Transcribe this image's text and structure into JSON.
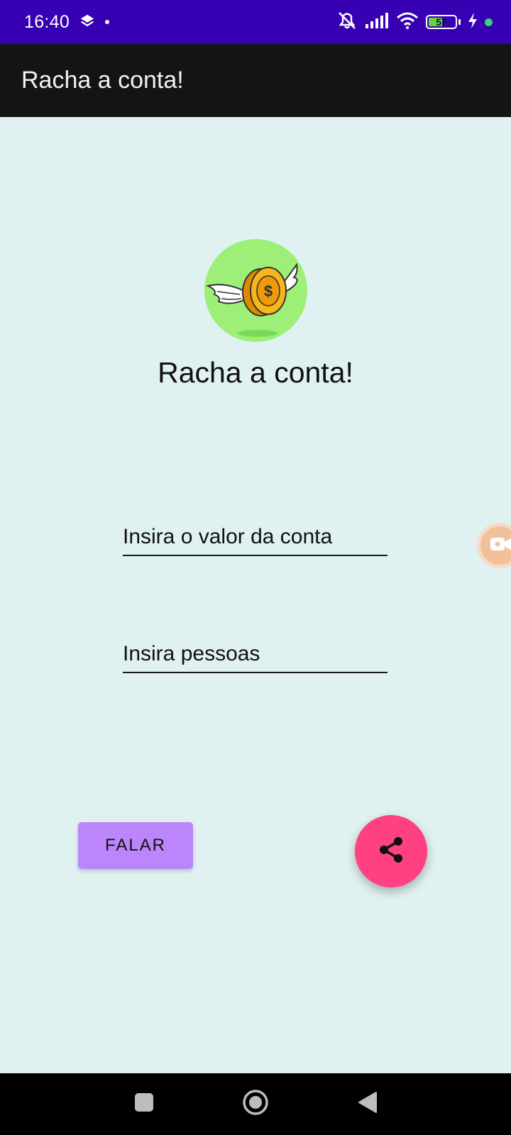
{
  "status_bar": {
    "time": "16:40",
    "battery_level": 57,
    "battery_label": "57"
  },
  "app_bar": {
    "title": "Racha a conta!"
  },
  "content": {
    "headline": "Racha a conta!",
    "valor_field": {
      "placeholder": "Insira o valor da conta",
      "value": ""
    },
    "pessoas_field": {
      "placeholder": "Insira pessoas",
      "value": ""
    },
    "speak_button_label": "FALAR"
  },
  "icons": {
    "logo": "flying-coin-icon",
    "share": "share-icon",
    "record": "screen-record-icon"
  },
  "colors": {
    "status_bar": "#3700b3",
    "app_bar": "#141414",
    "background": "#e0f1f1",
    "speak_button": "#bb86fc",
    "share_fab": "#ff4081",
    "logo_circle": "#9def78"
  }
}
